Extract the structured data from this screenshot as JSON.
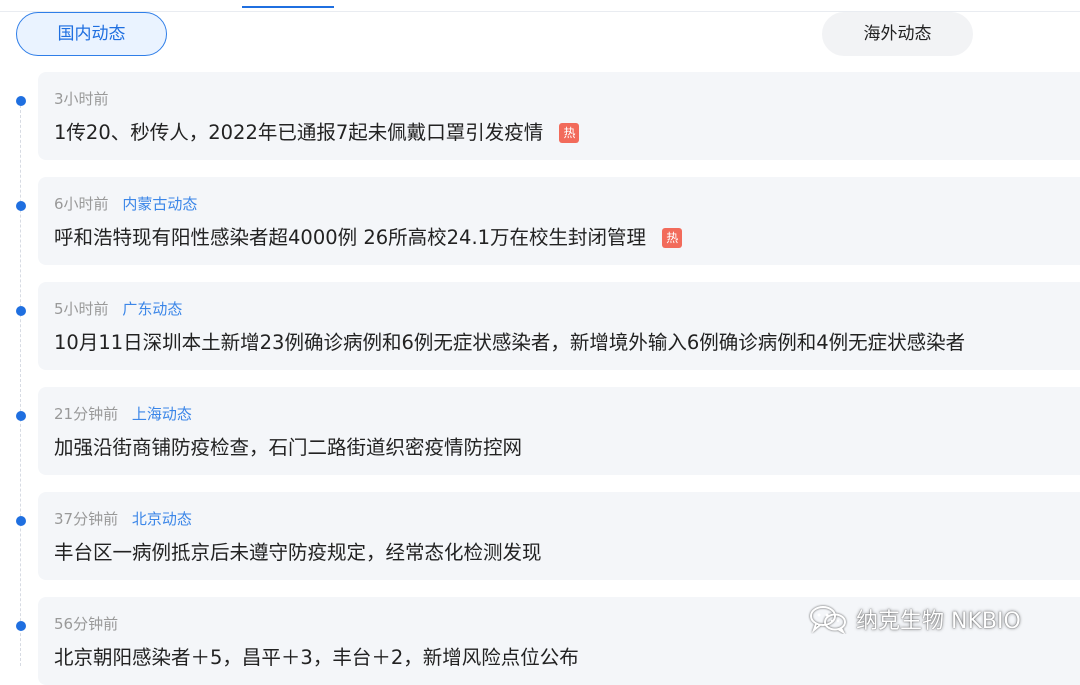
{
  "tabs": {
    "domestic": "国内动态",
    "overseas": "海外动态"
  },
  "news": [
    {
      "time": "3小时前",
      "region": "",
      "title": "1传20、秒传人，2022年已通报7起未佩戴口罩引发疫情",
      "hot": "热"
    },
    {
      "time": "6小时前",
      "region": "内蒙古动态",
      "title": "呼和浩特现有阳性感染者超4000例 26所高校24.1万在校生封闭管理",
      "hot": "热"
    },
    {
      "time": "5小时前",
      "region": "广东动态",
      "title": "10月11日深圳本土新增23例确诊病例和6例无症状感染者，新增境外输入6例确诊病例和4例无症状感染者",
      "hot": ""
    },
    {
      "time": "21分钟前",
      "region": "上海动态",
      "title": "加强沿街商铺防疫检查，石门二路街道织密疫情防控网",
      "hot": ""
    },
    {
      "time": "37分钟前",
      "region": "北京动态",
      "title": "丰台区一病例抵京后未遵守防疫规定，经常态化检测发现",
      "hot": ""
    },
    {
      "time": "56分钟前",
      "region": "",
      "title": "北京朝阳感染者＋5，昌平＋3，丰台＋2，新增风险点位公布",
      "hot": ""
    }
  ],
  "watermark": {
    "text": "纳克生物 NKBIO",
    "icon": "wechat-icon"
  },
  "colors": {
    "accent": "#1f6fe0",
    "region_link": "#3b86e8",
    "hot_badge": "#f26b5b",
    "card_bg": "#f4f6f9"
  }
}
